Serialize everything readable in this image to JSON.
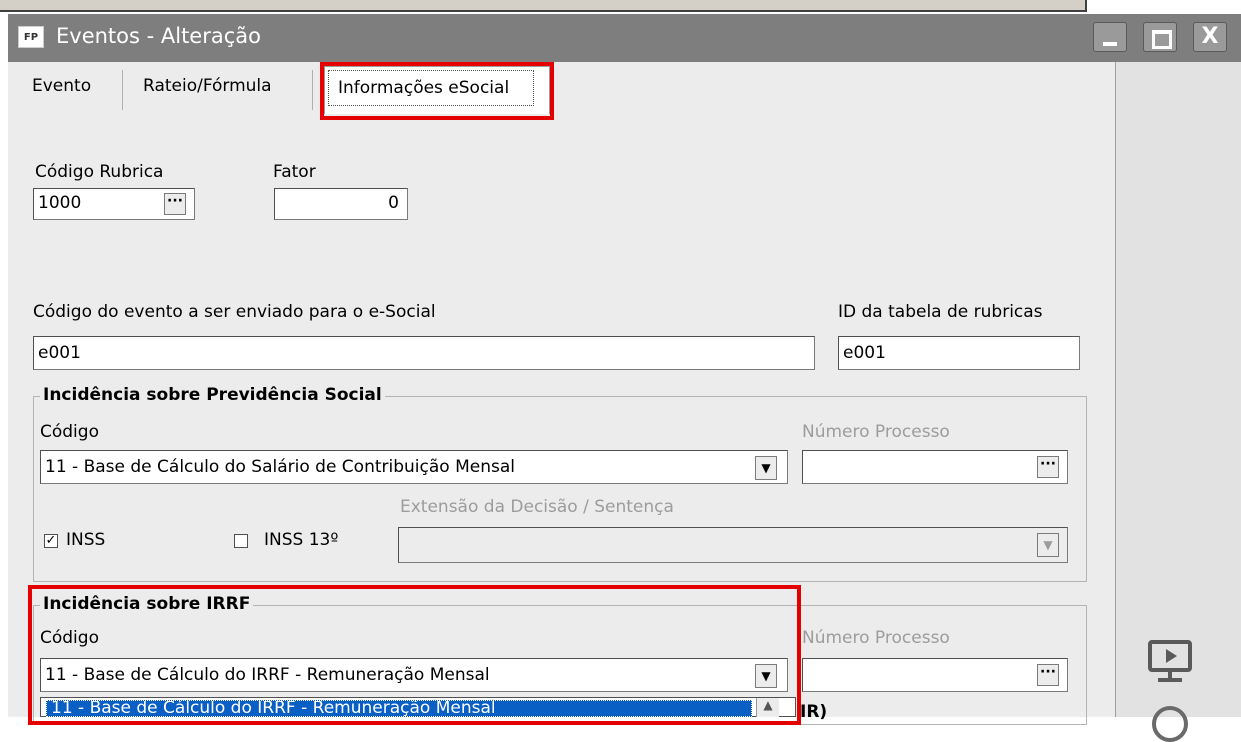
{
  "window": {
    "app_icon_text": "FP",
    "title": "Eventos - Alteração",
    "buttons": {
      "minimize_icon": "minimize-icon",
      "maximize_icon": "maximize-icon",
      "close_glyph": "X"
    }
  },
  "tabs": [
    {
      "label": "Evento",
      "active": false
    },
    {
      "label": "Rateio/Fórmula",
      "active": false
    },
    {
      "label": "Informações eSocial",
      "active": true
    }
  ],
  "form": {
    "codigo_rubrica": {
      "label": "Código Rubrica",
      "value": "1000",
      "button": "···"
    },
    "fator": {
      "label": "Fator",
      "value": "0"
    },
    "codigo_evento_esocial": {
      "label": "Código do evento a ser enviado para o e-Social",
      "value": "e001"
    },
    "id_tabela_rubricas": {
      "label": "ID da tabela de rubricas",
      "value": "e001"
    }
  },
  "previdencia": {
    "title": "Incidência sobre Previdência Social",
    "codigo_label": "Código",
    "codigo_value": "11 - Base de Cálculo do Salário de Contribuição Mensal",
    "numero_processo_label": "Número Processo",
    "numero_processo_value": "",
    "extensao_label": "Extensão da Decisão / Sentença",
    "extensao_value": "",
    "inss": {
      "label": "INSS",
      "checked": true
    },
    "inss13": {
      "label": "INSS 13º",
      "checked": false
    }
  },
  "irrf": {
    "title": "Incidência sobre IRRF",
    "codigo_label": "Código",
    "codigo_value": "11 - Base de Cálculo do IRRF - Remuneração Mensal",
    "numero_processo_label": "Número Processo",
    "numero_processo_value": "",
    "dropdown_selected": "11 - Base de Cálculo do IRRF - Remuneração Mensal",
    "partial_text": "IR)"
  },
  "glyphs": {
    "ellipsis": "···",
    "down_arrow": "▼",
    "check": "✓"
  },
  "colors": {
    "titlebar": "#7e7e7e",
    "highlight": "#e50000",
    "selection": "#0a5fc4",
    "window_bg": "#ececec"
  }
}
